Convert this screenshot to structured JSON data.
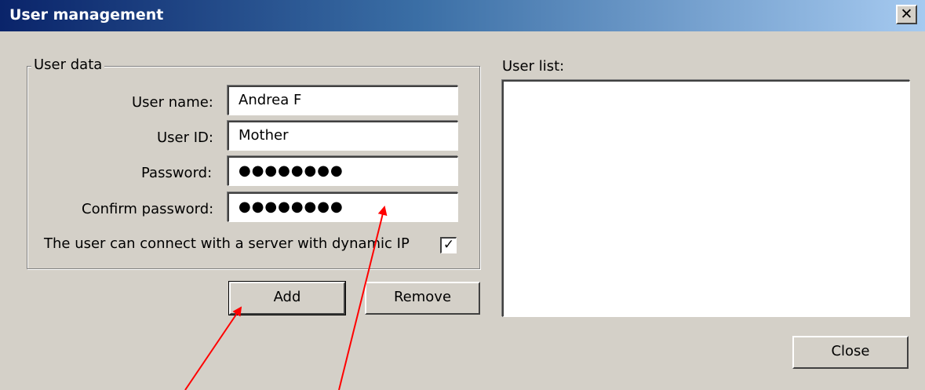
{
  "window": {
    "title": "User management",
    "close_glyph": "✕"
  },
  "user_data": {
    "group_label": "User data",
    "user_name_label": "User name:",
    "user_name_value": "Andrea F",
    "user_id_label": "User ID:",
    "user_id_value": "Mother",
    "password_label": "Password:",
    "password_value": "●●●●●●●●",
    "confirm_label": "Confirm password:",
    "confirm_value": "●●●●●●●●",
    "dynamic_ip_label": "The user can connect with a server with dynamic IP",
    "dynamic_ip_checked": true,
    "check_glyph": "✓"
  },
  "buttons": {
    "add": "Add",
    "remove": "Remove",
    "close": "Close"
  },
  "user_list": {
    "label": "User list:",
    "items": []
  },
  "colors": {
    "title_gradient_start": "#0a246a",
    "title_gradient_end": "#a6caf0",
    "annotation_arrow": "#ff0000",
    "dialog_face": "#d4d0c8"
  },
  "annotations": {
    "arrow_count": 2,
    "targets": [
      "add-button",
      "confirm-password-field"
    ]
  }
}
